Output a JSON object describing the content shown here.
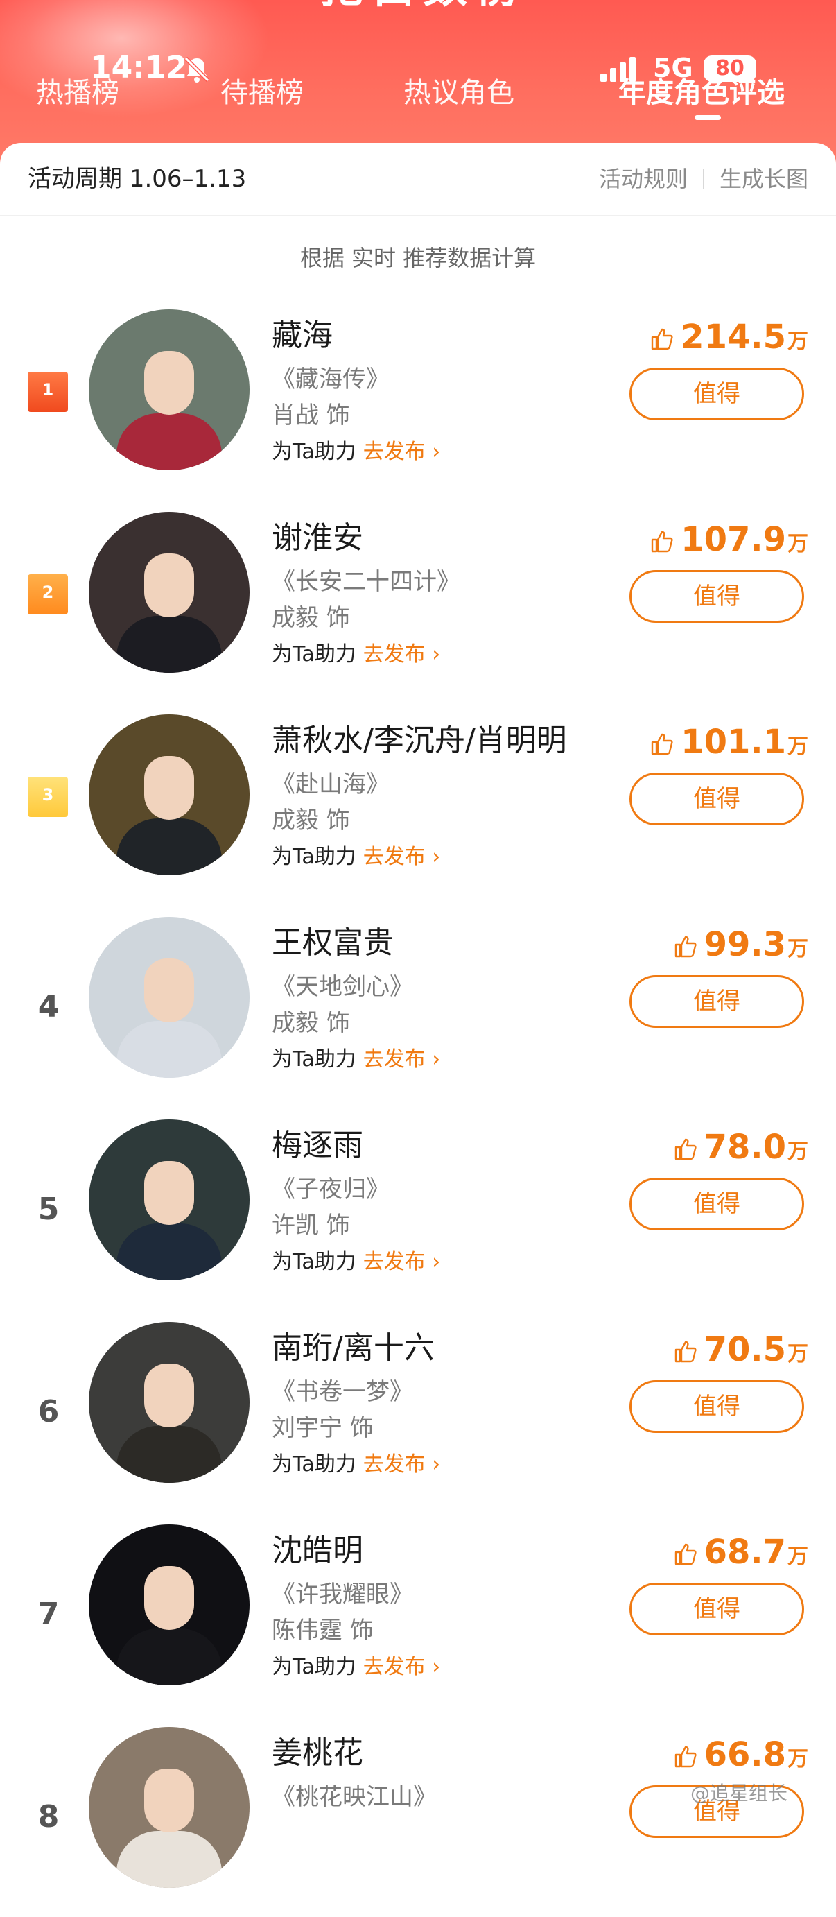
{
  "header": {
    "banner_title": "抢白数榜",
    "status": {
      "time": "14:12",
      "network": "5G",
      "battery": "80"
    },
    "tabs": [
      {
        "label": "热播榜"
      },
      {
        "label": "待播榜"
      },
      {
        "label": "热议角色"
      },
      {
        "label": "年度角色评选",
        "active": true
      }
    ]
  },
  "period_bar": {
    "period": "活动周期 1.06–1.13",
    "rules_label": "活动规则",
    "image_label": "生成长图"
  },
  "note": "根据 实时 推荐数据计算",
  "labels": {
    "help_prefix": "为Ta助力",
    "go_post": "去发布 ›",
    "vote_button": "值得",
    "unit": "万"
  },
  "items": [
    {
      "rank": "1",
      "name": "藏海",
      "drama": "《藏海传》",
      "actor": "肖战 饰",
      "votes": "214.5"
    },
    {
      "rank": "2",
      "name": "谢淮安",
      "drama": "《长安二十四计》",
      "actor": "成毅 饰",
      "votes": "107.9"
    },
    {
      "rank": "3",
      "name": "萧秋水/李沉舟/肖明明",
      "drama": "《赴山海》",
      "actor": "成毅 饰",
      "votes": "101.1"
    },
    {
      "rank": "4",
      "name": "王权富贵",
      "drama": "《天地剑心》",
      "actor": "成毅 饰",
      "votes": "99.3"
    },
    {
      "rank": "5",
      "name": "梅逐雨",
      "drama": "《子夜归》",
      "actor": "许凯 饰",
      "votes": "78.0"
    },
    {
      "rank": "6",
      "name": "南珩/离十六",
      "drama": "《书卷一梦》",
      "actor": "刘宇宁 饰",
      "votes": "70.5"
    },
    {
      "rank": "7",
      "name": "沈皓明",
      "drama": "《许我耀眼》",
      "actor": "陈伟霆 饰",
      "votes": "68.7"
    },
    {
      "rank": "8",
      "name": "姜桃花",
      "drama": "《桃花映江山》",
      "actor": "",
      "votes": "66.8"
    }
  ],
  "avatar_colors": [
    {
      "bg": "#6b7a6e",
      "body": "#a8283a"
    },
    {
      "bg": "#3a3030",
      "body": "#1c1c22"
    },
    {
      "bg": "#5a4a2a",
      "body": "#202428"
    },
    {
      "bg": "#cfd6dc",
      "body": "#d8dde4"
    },
    {
      "bg": "#2e3a3a",
      "body": "#1e2a3a"
    },
    {
      "bg": "#3c3c3a",
      "body": "#2c2a26"
    },
    {
      "bg": "#101014",
      "body": "#16161a"
    },
    {
      "bg": "#8a7a6a",
      "body": "#e8e2da"
    }
  ],
  "watermark": "@追星组长",
  "colors": {
    "accent": "#f07a12",
    "header": "#ff5a52"
  }
}
